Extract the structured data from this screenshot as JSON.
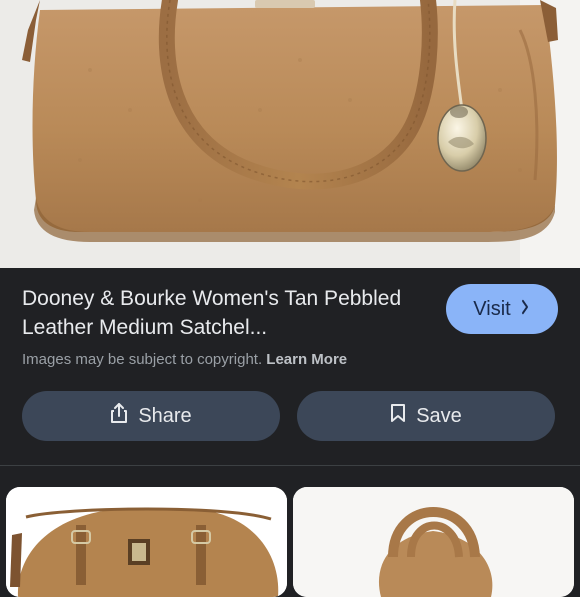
{
  "result": {
    "title": "Dooney & Bourke Women's Tan Pebbled Leather Medium Satchel...",
    "copyright_text": "Images may be subject to copyright.",
    "learn_more_label": "Learn More"
  },
  "actions": {
    "visit_label": "Visit",
    "share_label": "Share",
    "save_label": "Save"
  },
  "icons": {
    "visit": "chevron-right-icon",
    "share": "share-icon",
    "save": "bookmark-icon"
  },
  "colors": {
    "background": "#202124",
    "visit_button": "#8ab4f8",
    "action_button": "#3c4758",
    "bag_leather": "#b98a58"
  }
}
